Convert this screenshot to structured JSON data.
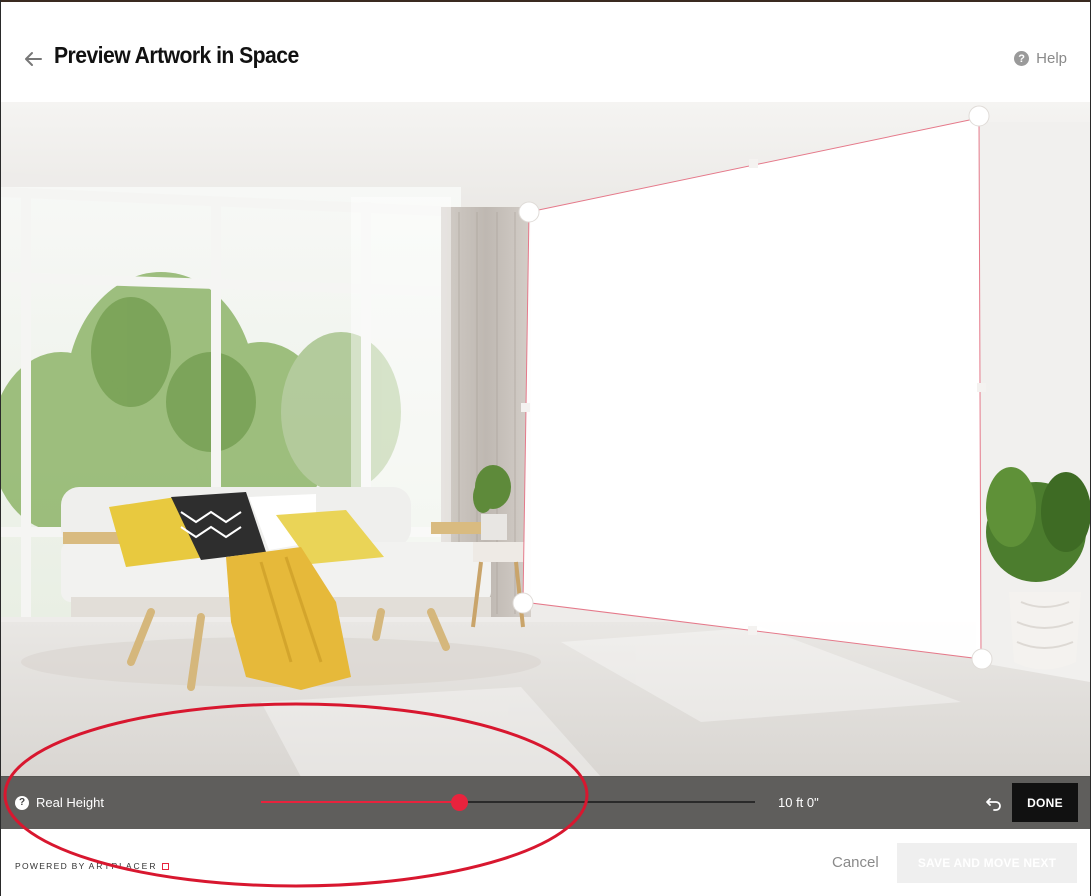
{
  "header": {
    "title": "Preview Artwork in Space",
    "help_label": "Help",
    "back_icon": "arrow-left-icon",
    "help_icon": "question-circle-icon"
  },
  "controls": {
    "real_height_label": "Real Height",
    "real_height_icon": "question-circle-icon",
    "height_value": "10 ft 0\"",
    "slider_fraction": 0.4,
    "undo_icon": "undo-icon",
    "done_label": "DONE"
  },
  "footer": {
    "powered_by": "POWERED BY",
    "brand": "ARTPLACER",
    "cancel_label": "Cancel",
    "save_label": "SAVE AND MOVE NEXT"
  },
  "colors": {
    "accent": "#e8233d",
    "bar": "#3c3a38",
    "done_button": "#111111",
    "annotation": "#d8172f"
  }
}
